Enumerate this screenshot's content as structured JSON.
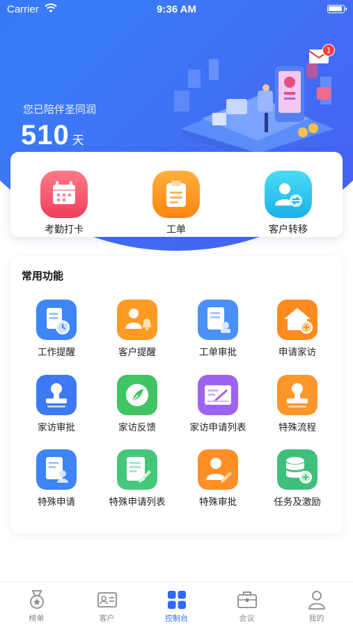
{
  "status_bar": {
    "carrier": "Carrier",
    "time": "9:36 AM"
  },
  "header": {
    "accompany_text": "您已陪伴圣同润",
    "days_value": "510",
    "days_unit": "天",
    "mail_badge_count": "1"
  },
  "quick_actions": [
    {
      "label": "考勤打卡",
      "icon": "calendar-check-icon",
      "color": "#f55a6e"
    },
    {
      "label": "工单",
      "icon": "clipboard-icon",
      "color": "#ff9a1f"
    },
    {
      "label": "客户转移",
      "icon": "user-transfer-icon",
      "color": "#2bc6f0"
    }
  ],
  "common_functions": {
    "title": "常用功能",
    "items": [
      {
        "label": "工作提醒",
        "icon": "document-clock-icon",
        "color": "#3c86f5"
      },
      {
        "label": "客户提醒",
        "icon": "user-bell-icon",
        "color": "#ff9a22"
      },
      {
        "label": "工单审批",
        "icon": "document-stamp-icon",
        "color": "#4a90f7"
      },
      {
        "label": "申请家访",
        "icon": "home-add-icon",
        "color": "#ff8a1f"
      },
      {
        "label": "家访审批",
        "icon": "stamp-icon",
        "color": "#3d79f2"
      },
      {
        "label": "家访反馈",
        "icon": "feather-icon",
        "color": "#41c463"
      },
      {
        "label": "家访申请列表",
        "icon": "signature-icon",
        "color": "#9e63f0"
      },
      {
        "label": "特殊流程",
        "icon": "stamp-icon",
        "color": "#ff962a"
      },
      {
        "label": "特殊申请",
        "icon": "document-person-icon",
        "color": "#3d84f4"
      },
      {
        "label": "特殊申请列表",
        "icon": "document-edit-icon",
        "color": "#45c77a"
      },
      {
        "label": "特殊审批",
        "icon": "user-edit-icon",
        "color": "#ff8f26"
      },
      {
        "label": "任务及激励",
        "icon": "database-add-icon",
        "color": "#3fbf7b"
      }
    ]
  },
  "tab_bar": {
    "tabs": [
      {
        "label": "榜单",
        "icon": "medal-icon",
        "active": false
      },
      {
        "label": "客户",
        "icon": "id-card-icon",
        "active": false
      },
      {
        "label": "控制台",
        "icon": "grid-icon",
        "active": true
      },
      {
        "label": "会议",
        "icon": "briefcase-icon",
        "active": false
      },
      {
        "label": "我的",
        "icon": "person-icon",
        "active": false
      }
    ],
    "active_color": "#2f6bf6",
    "inactive_color": "#8a8a8a"
  }
}
